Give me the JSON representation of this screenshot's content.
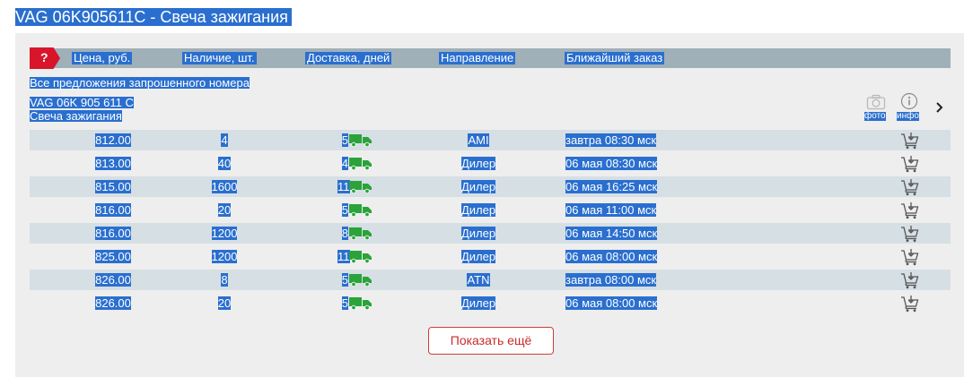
{
  "title": "VAG 06K905611C - Свеча зажигания",
  "badge": "?",
  "headers": {
    "price": "Цена, руб.",
    "stock": "Наличие, шт.",
    "delivery": "Доставка, дней",
    "direction": "Направление",
    "nearest": "Ближайший заказ"
  },
  "all_offers": "Все предложения запрошенного номера",
  "part_number": "VAG 06K 905 611 C",
  "part_name": "Свеча зажигания",
  "tools": {
    "photo": "фото",
    "info": "инфо"
  },
  "colors": {
    "accent": "#d8152b",
    "selection": "#2a6fcf",
    "truck": "#2aa33a",
    "header": "#9fb0b9",
    "row_alt": "#d6dfe4"
  },
  "offers": [
    {
      "price": "812.00",
      "stock": "4",
      "days": "5",
      "direction": "AMI",
      "nearest": "завтра 08:30 мск"
    },
    {
      "price": "813.00",
      "stock": "40",
      "days": "4",
      "direction": "Дилер",
      "nearest": "06 мая 08:30 мск"
    },
    {
      "price": "815.00",
      "stock": "1600",
      "days": "11",
      "direction": "Дилер",
      "nearest": "06 мая 16:25 мск"
    },
    {
      "price": "816.00",
      "stock": "20",
      "days": "5",
      "direction": "Дилер",
      "nearest": "06 мая 11:00 мск"
    },
    {
      "price": "816.00",
      "stock": "1200",
      "days": "8",
      "direction": "Дилер",
      "nearest": "06 мая 14:50 мск"
    },
    {
      "price": "825.00",
      "stock": "1200",
      "days": "11",
      "direction": "Дилер",
      "nearest": "06 мая 08:00 мск"
    },
    {
      "price": "826.00",
      "stock": "8",
      "days": "5",
      "direction": "ATN",
      "nearest": "завтра 08:00 мск"
    },
    {
      "price": "826.00",
      "stock": "20",
      "days": "5",
      "direction": "Дилер",
      "nearest": "06 мая 08:00 мск"
    }
  ],
  "show_more": "Показать ещё"
}
